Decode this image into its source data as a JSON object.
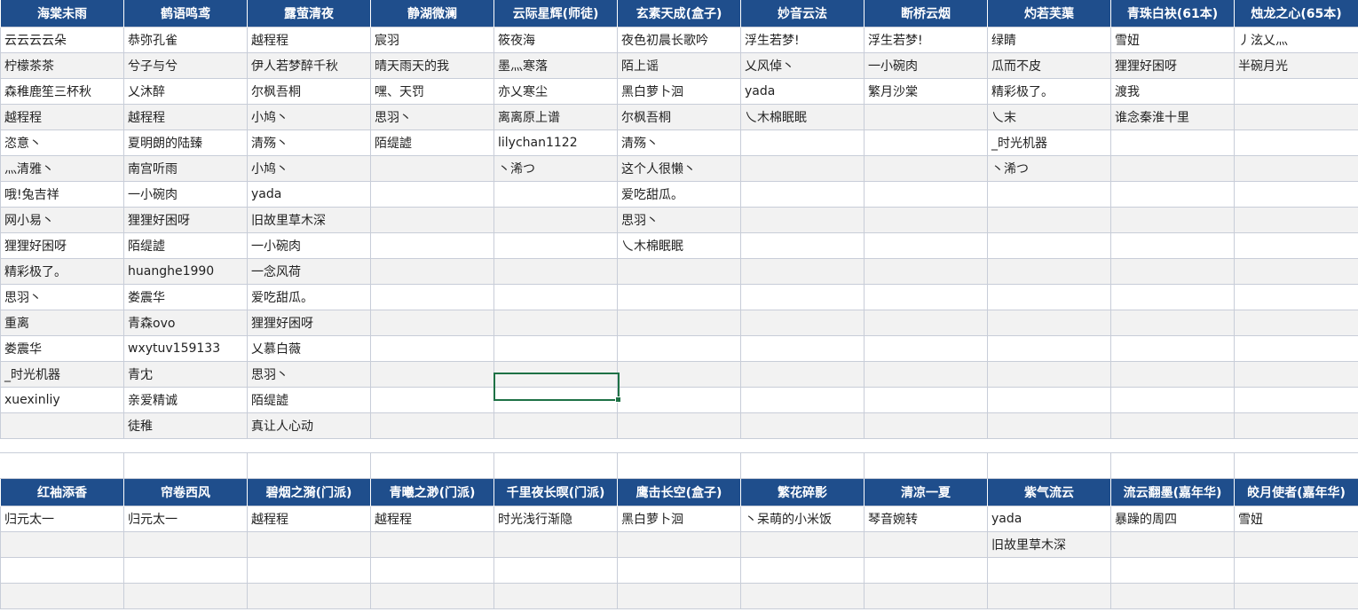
{
  "top": {
    "headers": [
      "海棠未雨",
      "鹤语鸣鸢",
      "露萤清夜",
      "静湖微澜",
      "云际星辉(师徒)",
      "玄素天成(盒子)",
      "妙音云法",
      "断桥云烟",
      "灼若芙蕖",
      "青珠白袂(61本)",
      "烛龙之心(65本)"
    ],
    "rows": [
      [
        "云云云云朵",
        "恭弥孔雀",
        "越程程",
        "宸羽",
        "筱夜海",
        "夜色初晨长歌吟",
        "浮生若梦!",
        "浮生若梦!",
        "绿睛",
        "雪妞",
        "丿泫乂灬"
      ],
      [
        "柠檬茶茶",
        "兮子与兮",
        "伊人若梦醉千秋",
        "晴天雨天的我",
        "墨灬寒落",
        "陌上谣",
        "乂风倬丶",
        "一小碗肉",
        "瓜而不皮",
        "狸狸好困呀",
        "半碗月光"
      ],
      [
        "森稚鹿笙三杯秋",
        "乂沐醉",
        "尔枫吾桐",
        "嘿、天罚",
        "亦乂寒尘",
        "黑白萝卜洄",
        "yada",
        "繁月沙棠",
        "精彩极了。",
        "渡我",
        ""
      ],
      [
        "越程程",
        "越程程",
        "小鸠丶",
        "思羽丶",
        "离离原上谱",
        "尔枫吾桐",
        "乀木棉眠眠",
        "",
        "乀末",
        "谁念秦淮十里",
        ""
      ],
      [
        "恣意丶",
        "夏明朗的陆臻",
        "清殇丶",
        "陌缇譃",
        "lilychan1122",
        "清殇丶",
        "",
        "",
        "_时光机器",
        "",
        ""
      ],
      [
        "灬清雅丶",
        "南宫听雨",
        "小鸠丶",
        "",
        "丶浠つ",
        "这个人很懒丶",
        "",
        "",
        "丶浠つ",
        "",
        ""
      ],
      [
        "哦!兔吉祥",
        "一小碗肉",
        "yada",
        "",
        "",
        "爱吃甜瓜。",
        "",
        "",
        "",
        "",
        ""
      ],
      [
        "网小易丶",
        "狸狸好困呀",
        "旧故里草木深",
        "",
        "",
        "思羽丶",
        "",
        "",
        "",
        "",
        ""
      ],
      [
        "狸狸好困呀",
        "陌缇譃",
        "一小碗肉",
        "",
        "",
        "乀木棉眠眠",
        "",
        "",
        "",
        "",
        ""
      ],
      [
        "精彩极了。",
        "huanghe1990",
        "一念风荷",
        "",
        "",
        "",
        "",
        "",
        "",
        "",
        ""
      ],
      [
        "思羽丶",
        "娄震华",
        "爱吃甜瓜。",
        "",
        "",
        "",
        "",
        "",
        "",
        "",
        ""
      ],
      [
        "重离",
        "青森ovo",
        "狸狸好困呀",
        "",
        "",
        "",
        "",
        "",
        "",
        "",
        ""
      ],
      [
        "娄震华",
        "wxytuv159133",
        "乂慕白薇",
        "",
        "",
        "",
        "",
        "",
        "",
        "",
        ""
      ],
      [
        "_时光机器",
        "青冘",
        "思羽丶",
        "",
        "",
        "",
        "",
        "",
        "",
        "",
        ""
      ],
      [
        "xuexinliy",
        "亲爱精诚",
        "陌缇譃",
        "",
        "",
        "",
        "",
        "",
        "",
        "",
        ""
      ],
      [
        "",
        "徒稚",
        "真让人心动",
        "",
        "",
        "",
        "",
        "",
        "",
        "",
        ""
      ]
    ]
  },
  "bottom": {
    "headers": [
      "红袖添香",
      "帘卷西风",
      "碧烟之漪(门派)",
      "青曦之渺(门派)",
      "千里夜长暝(门派)",
      "鹰击长空(盒子)",
      "繁花碎影",
      "清凉一夏",
      "紫气流云",
      "流云翻墨(嘉年华)",
      "皎月使者(嘉年华)"
    ],
    "rows": [
      [
        "归元太一",
        "归元太一",
        "越程程",
        "越程程",
        "时光浅行渐隐",
        "黑白萝卜洄",
        "丶呆萌的小米饭",
        "琴音婉转",
        "yada",
        "暴躁的周四",
        "雪妞"
      ],
      [
        "",
        "",
        "",
        "",
        "",
        "",
        "",
        "",
        "旧故里草木深",
        "",
        ""
      ],
      [
        "",
        "",
        "",
        "",
        "",
        "",
        "",
        "",
        "",
        "",
        ""
      ],
      [
        "",
        "",
        "",
        "",
        "",
        "",
        "",
        "",
        "",
        "",
        ""
      ]
    ]
  },
  "colors": {
    "header_bg": "#1f4e8c",
    "header_text": "#ffffff",
    "alt_row_bg": "#f2f2f2",
    "gridline": "#c8cdd8",
    "selection": "#1e7145"
  }
}
